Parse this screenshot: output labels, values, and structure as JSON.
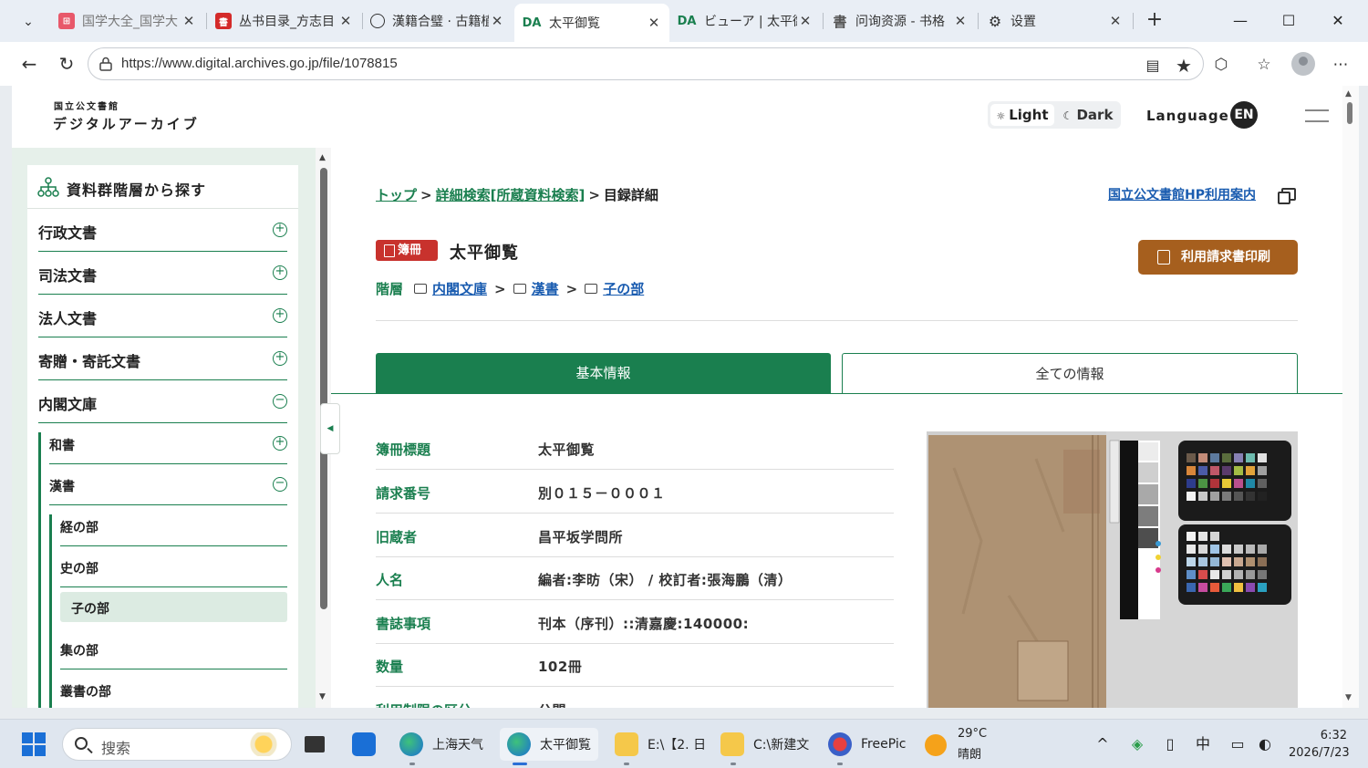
{
  "browser": {
    "tabs": [
      {
        "title": "国学大全_国学大",
        "active": false
      },
      {
        "title": "丛书目录_方志目",
        "active": false
      },
      {
        "title": "漢籍合璧 · 古籍植",
        "active": false
      },
      {
        "title": "太平御覧",
        "favicon": "DA",
        "active": true
      },
      {
        "title": "ビューア | 太平御",
        "favicon": "DA",
        "active": false
      },
      {
        "title": "问询资源 - 书格",
        "favicon": "書",
        "active": false
      },
      {
        "title": "设置",
        "active": false
      }
    ],
    "url": "https://www.digital.archives.go.jp/file/1078815"
  },
  "site": {
    "logo_small": "国立公文書館",
    "logo_big": "デジタルアーカイブ",
    "theme_light": "Light",
    "theme_dark": "Dark",
    "language_label": "Language",
    "language_code": "EN"
  },
  "sidebar": {
    "heading": "資料群階層から探す",
    "items": [
      {
        "label": "行政文書",
        "expanded": false
      },
      {
        "label": "司法文書",
        "expanded": false
      },
      {
        "label": "法人文書",
        "expanded": false
      },
      {
        "label": "寄贈・寄託文書",
        "expanded": false
      },
      {
        "label": "内閣文庫",
        "expanded": true
      }
    ],
    "sub_items": [
      {
        "label": "和書",
        "expanded": false
      },
      {
        "label": "漢書",
        "expanded": true
      }
    ],
    "sub_sub_items": [
      {
        "label": "経の部"
      },
      {
        "label": "史の部"
      },
      {
        "label": "子の部",
        "selected": true
      },
      {
        "label": "集の部"
      },
      {
        "label": "叢書の部"
      }
    ]
  },
  "breadcrumb": {
    "top": "トップ",
    "search": "詳細検索[所蔵資料検索]",
    "current": "目録詳細",
    "separator": ">"
  },
  "hp_link": "国立公文書館HP利用案内",
  "document": {
    "badge": "簿冊",
    "title": "太平御覧",
    "print_button": "利用請求書印刷"
  },
  "hierarchy": {
    "label": "階層",
    "path": [
      "内閣文庫",
      "漢書",
      "子の部"
    ]
  },
  "tabs": {
    "basic": "基本情報",
    "all": "全ての情報"
  },
  "info": [
    {
      "key": "簿冊標題",
      "value": "太平御覧"
    },
    {
      "key": "請求番号",
      "value": "別０１５－０００１"
    },
    {
      "key": "旧蔵者",
      "value": "昌平坂学問所"
    },
    {
      "key": "人名",
      "value": "編者:李昉（宋） / 校訂者:張海鵬（清）"
    },
    {
      "key": "書誌事項",
      "value": "刊本（序刊）::清嘉慶:140000:"
    },
    {
      "key": "数量",
      "value": "102冊"
    },
    {
      "key": "利用制限の区分",
      "value": "公開"
    }
  ],
  "taskbar": {
    "search_placeholder": "搜索",
    "apps": [
      "上海天气",
      "太平御覧",
      "E:\\【2. 日",
      "C:\\新建文",
      "FreePic"
    ],
    "weather_temp": "29°C",
    "weather_state": "晴朗",
    "ime": "中",
    "time": "6:32",
    "date": "2026/7/23"
  },
  "colors": {
    "accent_green": "#1a7f4f",
    "badge_red": "#c8322d",
    "print_brown": "#a65f1e",
    "link_blue": "#1a5cb0"
  }
}
